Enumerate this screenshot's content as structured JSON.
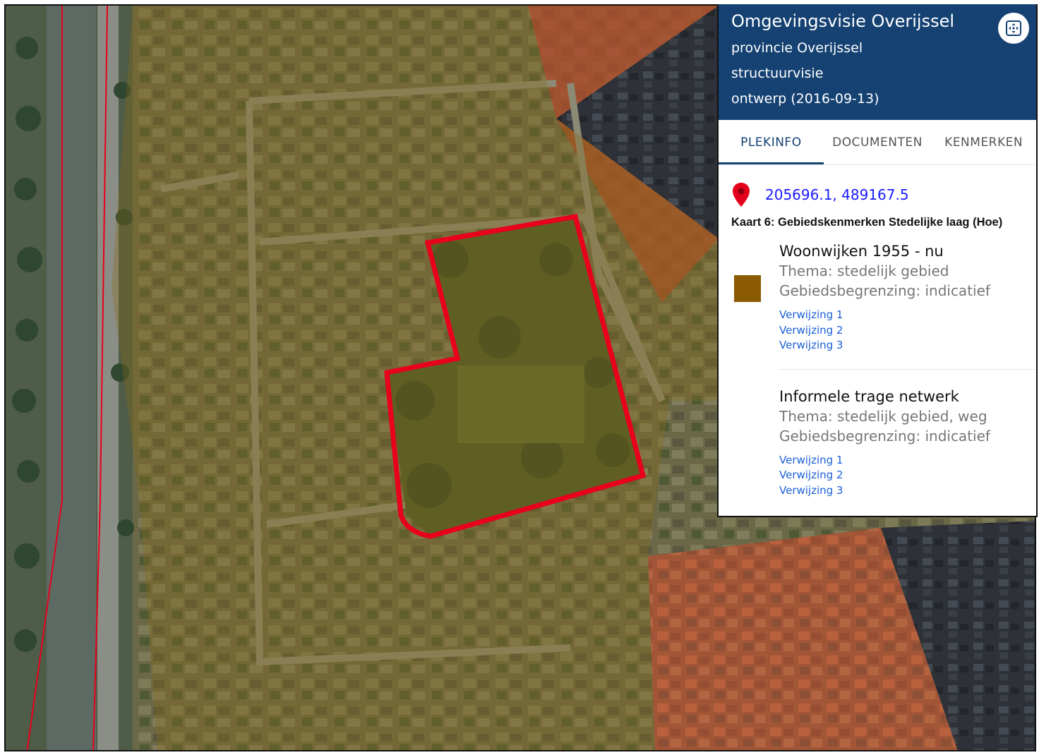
{
  "panel": {
    "title": "Omgevingsvisie Overijssel",
    "subtitle_lines": [
      "provincie Overijssel",
      "structuurvisie",
      "ontwerp (2016-09-13)"
    ],
    "expand_icon": "expand-icon"
  },
  "tabs": [
    {
      "label": "PLEKINFO",
      "active": true
    },
    {
      "label": "DOCUMENTEN",
      "active": false
    },
    {
      "label": "KENMERKEN",
      "active": false
    }
  ],
  "location": {
    "coordinates": "205696.1, 489167.5",
    "pin_icon": "map-pin-icon",
    "pin_color": "#e3001b"
  },
  "map_name": "Kaart 6: Gebiedskenmerken Stedelijke laag (Hoe)",
  "legend": [
    {
      "title": "Woonwijken 1955 - nu",
      "thema": "Thema: stedelijk gebied",
      "begrenzing": "Gebiedsbegrenzing: indicatief",
      "swatch_color": "#8a5a00",
      "links": [
        "Verwijzing 1",
        "Verwijzing 2",
        "Verwijzing 3"
      ]
    },
    {
      "title": "Informele trage netwerk",
      "thema": "Thema: stedelijk gebied, weg",
      "begrenzing": "Gebiedsbegrenzing: indicatief",
      "links": [
        "Verwijzing 1",
        "Verwijzing 2",
        "Verwijzing 3"
      ]
    }
  ],
  "colors": {
    "header_bg": "#154273",
    "highlight_outline": "#e8001c",
    "overlay_residential": "#8a6a12",
    "overlay_center": "#b04a2a"
  }
}
